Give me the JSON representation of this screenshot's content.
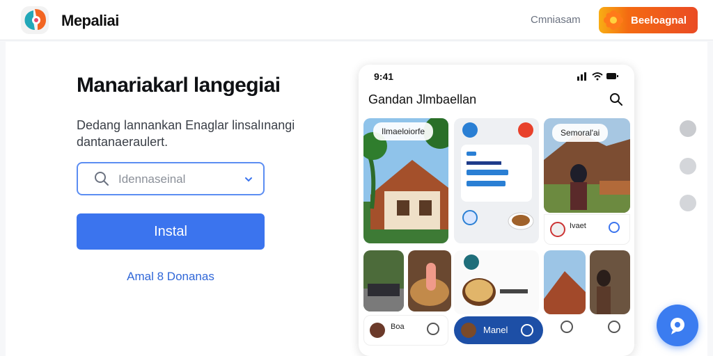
{
  "header": {
    "app_name": "Mepaliai",
    "secondary_link": "Cmniasam",
    "install_button": "Beeloagnal"
  },
  "hero": {
    "title": "Manariakarl langegiai",
    "subtitle": "Dedang lannankan Enaglar linsalınangi dantanaeraulert.",
    "search_placeholder": "Idennaseinal",
    "install_label": "Instal",
    "alt_link": "Amal 8 Donanas"
  },
  "phone": {
    "time": "9:41",
    "title": "Gandan Jlmbaellan",
    "tiles": [
      {
        "chip": "Ilmaeloiorfe"
      },
      {
        "chip": "Semoral'ai"
      },
      {
        "label": "Ivaet"
      },
      {
        "label": "Boa"
      },
      {
        "label": "Manel"
      }
    ]
  },
  "colors": {
    "primary": "#3b74ee",
    "accent_orange": "#f46a12",
    "active_pill": "#1d4fa6"
  },
  "icons": [
    "app-logo-icon",
    "flower-icon",
    "search-icon",
    "chevron-down-icon",
    "wifi-icon",
    "battery-icon",
    "chat-icon"
  ]
}
